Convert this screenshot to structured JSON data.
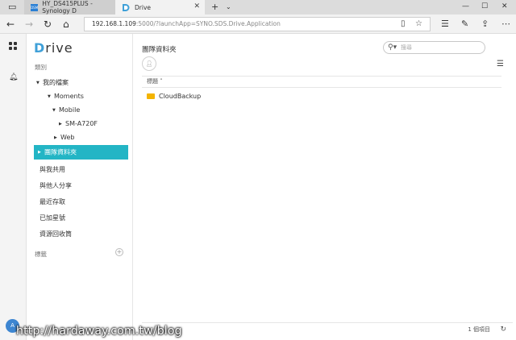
{
  "browser": {
    "tabs": [
      {
        "title": "HY_DS415PLUS - Synology D",
        "favicon": "DSM"
      },
      {
        "title": "Drive"
      }
    ],
    "url_host": "192.168.1.109",
    "url_rest": ":5000/?launchApp=SYNO.SDS.Drive.Application"
  },
  "app": {
    "logo_initial": "D",
    "logo_rest": "rive",
    "section_category": "類別",
    "tree": {
      "my_files": "我的檔案",
      "moments": "Moments",
      "mobile": "Mobile",
      "device": "SM-A720F",
      "web": "Web"
    },
    "selected": "團隊資料夾",
    "nav_items": [
      "與我共用",
      "與他人分享",
      "最近存取",
      "已加星號",
      "資源回收筒"
    ],
    "section_labels": "標籤",
    "avatar_text": "A"
  },
  "main": {
    "title": "團隊資料夾",
    "search_placeholder": "搜尋",
    "column_header": "標題 ˄",
    "rows": [
      {
        "name": "CloudBackup"
      }
    ],
    "item_count": "1 個項目"
  },
  "watermark": "http://hardaway.com.tw/blog"
}
